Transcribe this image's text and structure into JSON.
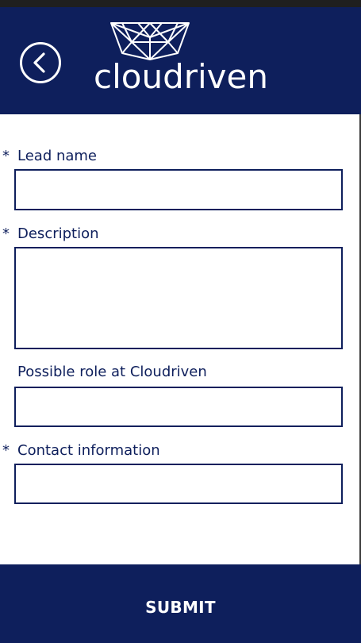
{
  "header": {
    "brand_name": "cloudriven",
    "back_icon": "chevron-left-circle-icon",
    "logo_icon": "geometric-crown-logo-icon"
  },
  "form": {
    "fields": [
      {
        "label": "Lead name",
        "required": true,
        "required_marker": "*",
        "value": "",
        "type": "text"
      },
      {
        "label": "Description",
        "required": true,
        "required_marker": "*",
        "value": "",
        "type": "textarea"
      },
      {
        "label": "Possible role at Cloudriven",
        "required": false,
        "required_marker": "",
        "value": "",
        "type": "text"
      },
      {
        "label": "Contact information",
        "required": true,
        "required_marker": "*",
        "value": "",
        "type": "text"
      }
    ]
  },
  "footer": {
    "submit_label": "SUBMIT"
  },
  "colors": {
    "primary": "#0e1f5c",
    "background": "#ffffff",
    "top_strip": "#1f1f1f",
    "text_on_primary": "#ffffff"
  }
}
